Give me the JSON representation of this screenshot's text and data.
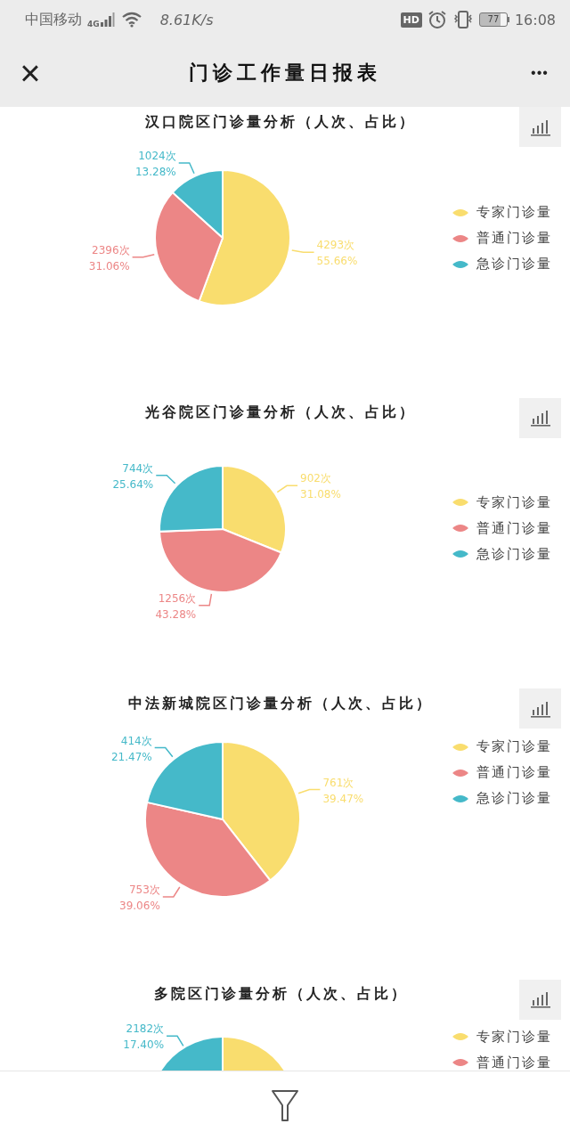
{
  "status_bar": {
    "carrier": "中国移动",
    "network": "4G",
    "speed": "8.61K/s",
    "hd": "HD",
    "battery": "77",
    "time": "16:08"
  },
  "nav": {
    "close": "×",
    "title": "门诊工作量日报表",
    "more": "•••"
  },
  "charts": [
    {
      "title": "汉口院区门诊量分析（人次、占比）",
      "chart_data": {
        "type": "pie",
        "legend": "right",
        "categories": [
          "专家门诊量",
          "普通门诊量",
          "急诊门诊量"
        ],
        "colors": [
          "#f9dd6e",
          "#ec8686",
          "#45b9c9"
        ],
        "values": [
          55.66,
          31.06,
          13.28
        ],
        "value_labels": [
          [
            "4293次",
            "55.66%"
          ],
          [
            "2396次",
            "31.06%"
          ],
          [
            "1024次",
            "13.28%"
          ]
        ]
      }
    },
    {
      "title": "光谷院区门诊量分析（人次、占比）",
      "chart_data": {
        "type": "pie",
        "legend": "right",
        "categories": [
          "专家门诊量",
          "普通门诊量",
          "急诊门诊量"
        ],
        "colors": [
          "#f9dd6e",
          "#ec8686",
          "#45b9c9"
        ],
        "values": [
          31.08,
          43.28,
          25.64
        ],
        "value_labels": [
          [
            "902次",
            "31.08%"
          ],
          [
            "1256次",
            "43.28%"
          ],
          [
            "744次",
            "25.64%"
          ]
        ]
      }
    },
    {
      "title": "中法新城院区门诊量分析（人次、占比）",
      "chart_data": {
        "type": "pie",
        "legend": "right",
        "categories": [
          "专家门诊量",
          "普通门诊量",
          "急诊门诊量"
        ],
        "colors": [
          "#f9dd6e",
          "#ec8686",
          "#45b9c9"
        ],
        "values": [
          39.47,
          39.06,
          21.47
        ],
        "value_labels": [
          [
            "761次",
            "39.47%"
          ],
          [
            "753次",
            "39.06%"
          ],
          [
            "414次",
            "21.47%"
          ]
        ]
      }
    },
    {
      "title": "多院区门诊量分析（人次、占比）",
      "legend": [
        {
          "label": "专家门诊量",
          "color": "#f9dd6e"
        },
        {
          "label": "普通门诊量",
          "color": "#ec8686"
        }
      ],
      "slice_label": {
        "lines": [
          "2182次",
          "17.40%"
        ],
        "color": "#45b9c9"
      }
    }
  ]
}
